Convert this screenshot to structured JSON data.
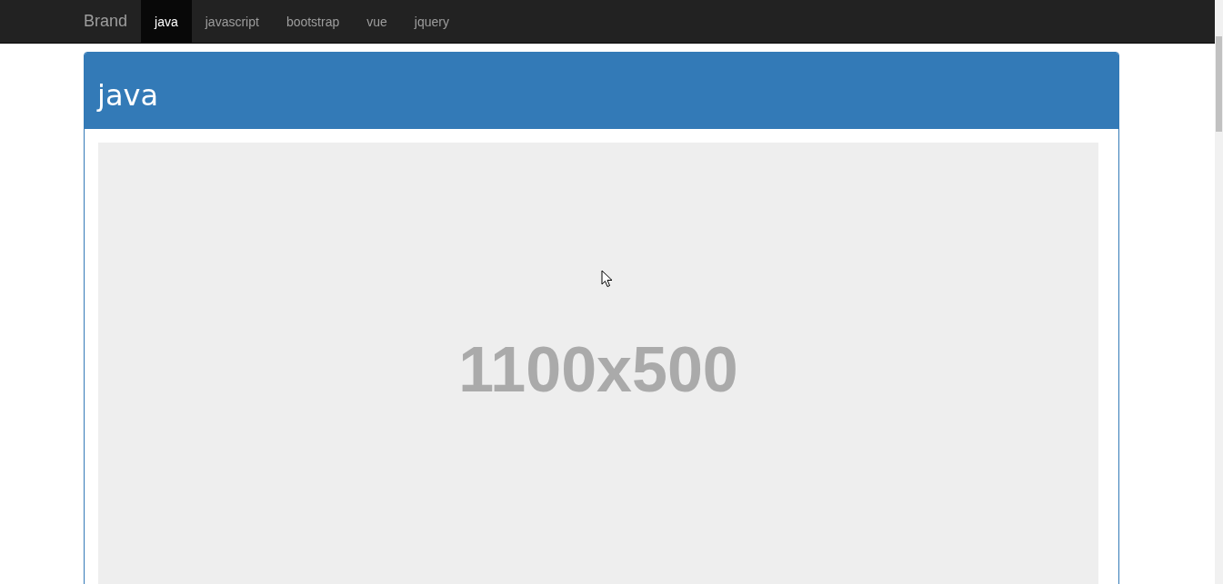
{
  "navbar": {
    "brand": "Brand",
    "tabs": [
      {
        "label": "java",
        "selected": true
      },
      {
        "label": "javascript",
        "selected": false
      },
      {
        "label": "bootstrap",
        "selected": false
      },
      {
        "label": "vue",
        "selected": false
      },
      {
        "label": "jquery",
        "selected": false
      }
    ]
  },
  "panel": {
    "title": "java",
    "image_label": "1100x500"
  }
}
